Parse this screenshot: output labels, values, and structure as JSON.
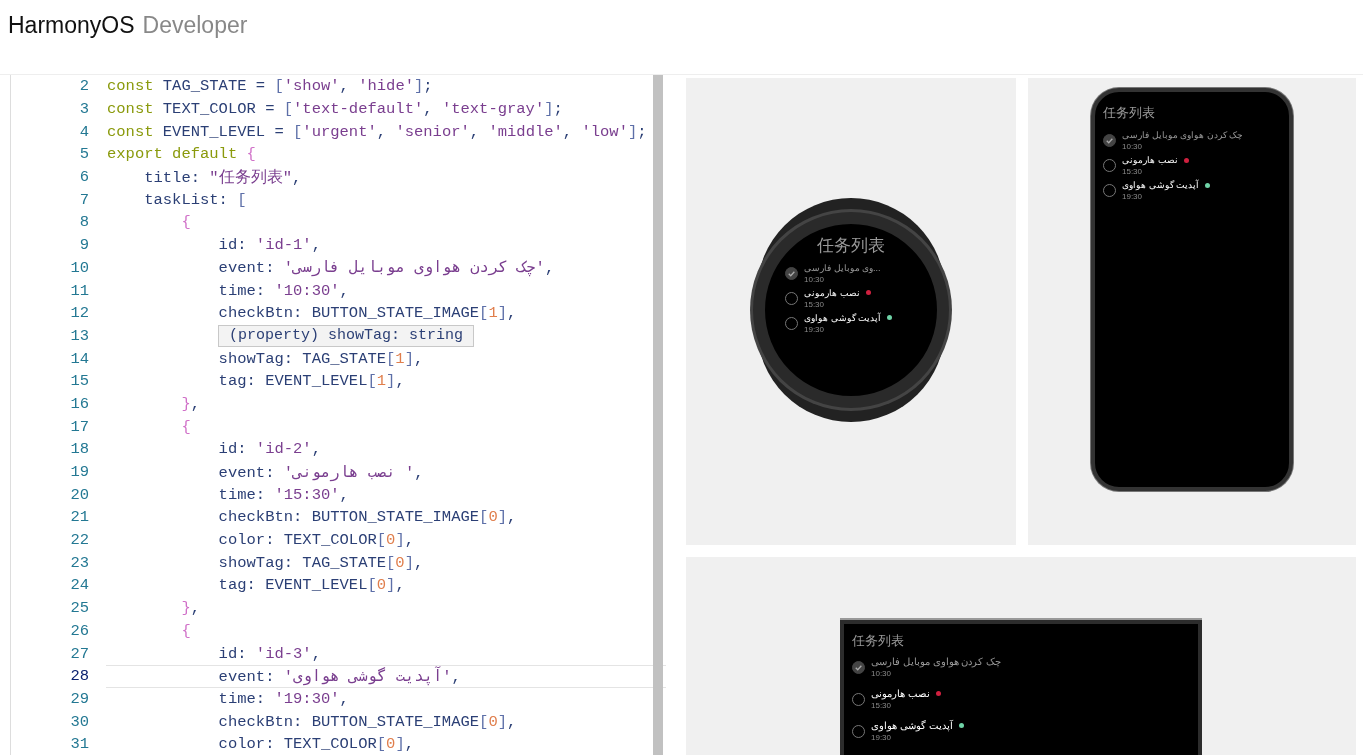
{
  "header": {
    "brand": "HarmonyOS",
    "product": "Developer"
  },
  "editor": {
    "lines": [
      {
        "n": "2",
        "current": false,
        "tokens": [
          {
            "kind": "kw",
            "text": "const "
          },
          {
            "kind": "id",
            "text": "TAG_STATE = "
          },
          {
            "kind": "bracket",
            "text": "["
          },
          {
            "kind": "str",
            "text": "'show'"
          },
          {
            "kind": "id",
            "text": ", "
          },
          {
            "kind": "str",
            "text": "'hide'"
          },
          {
            "kind": "bracket",
            "text": "]"
          },
          {
            "kind": "id",
            "text": ";"
          }
        ]
      },
      {
        "n": "3",
        "current": false,
        "tokens": [
          {
            "kind": "kw",
            "text": "const "
          },
          {
            "kind": "id",
            "text": "TEXT_COLOR = "
          },
          {
            "kind": "bracket",
            "text": "["
          },
          {
            "kind": "str",
            "text": "'text-default'"
          },
          {
            "kind": "id",
            "text": ", "
          },
          {
            "kind": "str",
            "text": "'text-gray'"
          },
          {
            "kind": "bracket",
            "text": "]"
          },
          {
            "kind": "id",
            "text": ";"
          }
        ]
      },
      {
        "n": "4",
        "current": false,
        "tokens": [
          {
            "kind": "kw",
            "text": "const "
          },
          {
            "kind": "id",
            "text": "EVENT_LEVEL = "
          },
          {
            "kind": "bracket",
            "text": "["
          },
          {
            "kind": "str",
            "text": "'urgent'"
          },
          {
            "kind": "id",
            "text": ", "
          },
          {
            "kind": "str",
            "text": "'senior'"
          },
          {
            "kind": "id",
            "text": ", "
          },
          {
            "kind": "str",
            "text": "'middle'"
          },
          {
            "kind": "id",
            "text": ", "
          },
          {
            "kind": "str",
            "text": "'low'"
          },
          {
            "kind": "bracket",
            "text": "]"
          },
          {
            "kind": "id",
            "text": ";"
          }
        ]
      },
      {
        "n": "5",
        "current": false,
        "tokens": [
          {
            "kind": "kw",
            "text": "export default "
          },
          {
            "kind": "brace",
            "text": "{"
          }
        ]
      },
      {
        "n": "6",
        "current": false,
        "tokens": [
          {
            "kind": "id",
            "text": "    title: "
          },
          {
            "kind": "str",
            "text": "\"任务列表\""
          },
          {
            "kind": "id",
            "text": ","
          }
        ]
      },
      {
        "n": "7",
        "current": false,
        "tokens": [
          {
            "kind": "id",
            "text": "    taskList: "
          },
          {
            "kind": "bracket",
            "text": "["
          }
        ]
      },
      {
        "n": "8",
        "current": false,
        "tokens": [
          {
            "kind": "brace",
            "text": "        {"
          }
        ]
      },
      {
        "n": "9",
        "current": false,
        "tokens": [
          {
            "kind": "id",
            "text": "            id: "
          },
          {
            "kind": "str",
            "text": "'id-1'"
          },
          {
            "kind": "id",
            "text": ","
          }
        ]
      },
      {
        "n": "10",
        "current": false,
        "tokens": [
          {
            "kind": "id",
            "text": "            event: "
          },
          {
            "kind": "str",
            "text": "'چک کردن هواوی موبایل فارسی'"
          },
          {
            "kind": "id",
            "text": ","
          }
        ]
      },
      {
        "n": "11",
        "current": false,
        "tokens": [
          {
            "kind": "id",
            "text": "            time: "
          },
          {
            "kind": "str",
            "text": "'10:30'"
          },
          {
            "kind": "id",
            "text": ","
          }
        ]
      },
      {
        "n": "12",
        "current": false,
        "tokens": [
          {
            "kind": "id",
            "text": "            checkBtn: BUTTON_STATE_IMAGE"
          },
          {
            "kind": "bracket",
            "text": "["
          },
          {
            "kind": "num",
            "text": "1"
          },
          {
            "kind": "bracket",
            "text": "]"
          },
          {
            "kind": "id",
            "text": ","
          }
        ]
      },
      {
        "n": "13",
        "current": false
      },
      {
        "n": "14",
        "current": false,
        "tokens": [
          {
            "kind": "id",
            "text": "            showTag: TAG_STATE"
          },
          {
            "kind": "bracket",
            "text": "["
          },
          {
            "kind": "num",
            "text": "1"
          },
          {
            "kind": "bracket",
            "text": "]"
          },
          {
            "kind": "id",
            "text": ","
          }
        ]
      },
      {
        "n": "15",
        "current": false,
        "tokens": [
          {
            "kind": "id",
            "text": "            tag: EVENT_LEVEL"
          },
          {
            "kind": "bracket",
            "text": "["
          },
          {
            "kind": "num",
            "text": "1"
          },
          {
            "kind": "bracket",
            "text": "]"
          },
          {
            "kind": "id",
            "text": ","
          }
        ]
      },
      {
        "n": "16",
        "current": false,
        "tokens": [
          {
            "kind": "brace",
            "text": "        }"
          },
          {
            "kind": "id",
            "text": ","
          }
        ]
      },
      {
        "n": "17",
        "current": false,
        "tokens": [
          {
            "kind": "brace",
            "text": "        {"
          }
        ]
      },
      {
        "n": "18",
        "current": false,
        "tokens": [
          {
            "kind": "id",
            "text": "            id: "
          },
          {
            "kind": "str",
            "text": "'id-2'"
          },
          {
            "kind": "id",
            "text": ","
          }
        ]
      },
      {
        "n": "19",
        "current": false,
        "tokens": [
          {
            "kind": "id",
            "text": "            event: "
          },
          {
            "kind": "str",
            "text": "'نصب هارمونی '"
          },
          {
            "kind": "id",
            "text": ","
          }
        ]
      },
      {
        "n": "20",
        "current": false,
        "tokens": [
          {
            "kind": "id",
            "text": "            time: "
          },
          {
            "kind": "str",
            "text": "'15:30'"
          },
          {
            "kind": "id",
            "text": ","
          }
        ]
      },
      {
        "n": "21",
        "current": false,
        "tokens": [
          {
            "kind": "id",
            "text": "            checkBtn: BUTTON_STATE_IMAGE"
          },
          {
            "kind": "bracket",
            "text": "["
          },
          {
            "kind": "num",
            "text": "0"
          },
          {
            "kind": "bracket",
            "text": "]"
          },
          {
            "kind": "id",
            "text": ","
          }
        ]
      },
      {
        "n": "22",
        "current": false,
        "tokens": [
          {
            "kind": "id",
            "text": "            color: TEXT_COLOR"
          },
          {
            "kind": "bracket",
            "text": "["
          },
          {
            "kind": "num",
            "text": "0"
          },
          {
            "kind": "bracket",
            "text": "]"
          },
          {
            "kind": "id",
            "text": ","
          }
        ]
      },
      {
        "n": "23",
        "current": false,
        "tokens": [
          {
            "kind": "id",
            "text": "            showTag: TAG_STATE"
          },
          {
            "kind": "bracket",
            "text": "["
          },
          {
            "kind": "num",
            "text": "0"
          },
          {
            "kind": "bracket",
            "text": "]"
          },
          {
            "kind": "id",
            "text": ","
          }
        ]
      },
      {
        "n": "24",
        "current": false,
        "tokens": [
          {
            "kind": "id",
            "text": "            tag: EVENT_LEVEL"
          },
          {
            "kind": "bracket",
            "text": "["
          },
          {
            "kind": "num",
            "text": "0"
          },
          {
            "kind": "bracket",
            "text": "]"
          },
          {
            "kind": "id",
            "text": ","
          }
        ]
      },
      {
        "n": "25",
        "current": false,
        "tokens": [
          {
            "kind": "brace",
            "text": "        }"
          },
          {
            "kind": "id",
            "text": ","
          }
        ]
      },
      {
        "n": "26",
        "current": false,
        "tokens": [
          {
            "kind": "brace",
            "text": "        {"
          }
        ]
      },
      {
        "n": "27",
        "current": false,
        "tokens": [
          {
            "kind": "id",
            "text": "            id: "
          },
          {
            "kind": "str",
            "text": "'id-3'"
          },
          {
            "kind": "id",
            "text": ","
          }
        ]
      },
      {
        "n": "28",
        "current": true,
        "tokens": [
          {
            "kind": "id",
            "text": "            event: "
          },
          {
            "kind": "str",
            "text": "'آپدیت گوشی هواوی'"
          },
          {
            "kind": "id",
            "text": ","
          }
        ]
      },
      {
        "n": "29",
        "current": false,
        "tokens": [
          {
            "kind": "id",
            "text": "            time: "
          },
          {
            "kind": "str",
            "text": "'19:30'"
          },
          {
            "kind": "id",
            "text": ","
          }
        ]
      },
      {
        "n": "30",
        "current": false,
        "tokens": [
          {
            "kind": "id",
            "text": "            checkBtn: BUTTON_STATE_IMAGE"
          },
          {
            "kind": "bracket",
            "text": "["
          },
          {
            "kind": "num",
            "text": "0"
          },
          {
            "kind": "bracket",
            "text": "]"
          },
          {
            "kind": "id",
            "text": ","
          }
        ]
      },
      {
        "n": "31",
        "current": false,
        "tokens": [
          {
            "kind": "id",
            "text": "            color: TEXT_COLOR"
          },
          {
            "kind": "bracket",
            "text": "["
          },
          {
            "kind": "num",
            "text": "0"
          },
          {
            "kind": "bracket",
            "text": "]"
          },
          {
            "kind": "id",
            "text": ","
          }
        ]
      }
    ],
    "tooltip": "(property) showTag: string"
  },
  "previews": [
    {
      "kind": "watch",
      "title": "任务列表",
      "tasks": [
        {
          "event": "...وی موبایل فارسی",
          "time": "10:30",
          "checked": true
        },
        {
          "event": "نصب هارمونی",
          "time": "15:30",
          "checked": false,
          "color": "#d0203f"
        },
        {
          "event": "آپدیت گوشی هواوی",
          "time": "19:30",
          "checked": false,
          "color": "#6fd3a7"
        }
      ]
    },
    {
      "kind": "phone",
      "title": "任务列表",
      "tasks": [
        {
          "event": "چک کردن هواوی موبایل فارسی",
          "time": "10:30",
          "checked": true
        },
        {
          "event": "نصب هارمونی",
          "time": "15:30",
          "checked": false,
          "color": "#d0203f"
        },
        {
          "event": "آپدیت گوشی هواوی",
          "time": "19:30",
          "checked": false,
          "color": "#6fd3a7"
        }
      ]
    },
    {
      "kind": "tv",
      "title": "任务列表",
      "tasks": [
        {
          "event": "چک کردن هواوی موبایل فارسی",
          "time": "10:30",
          "checked": true
        },
        {
          "event": "نصب هارمونی",
          "time": "15:30",
          "checked": false,
          "color": "#d0203f"
        },
        {
          "event": "آپدیت گوشی هواوی",
          "time": "19:30",
          "checked": false,
          "color": "#6fd3a7"
        }
      ]
    }
  ]
}
